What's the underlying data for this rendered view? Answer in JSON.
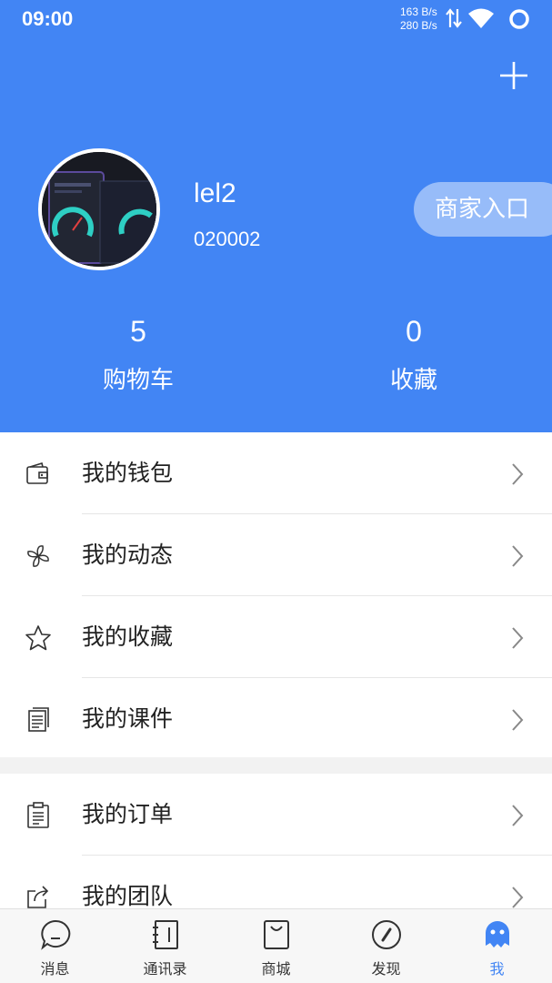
{
  "status_bar": {
    "time": "09:00",
    "upload_speed": "163 B/s",
    "download_speed": "280 B/s"
  },
  "profile": {
    "username": "lel2",
    "user_id": "020002",
    "merchant_entry": "商家入口"
  },
  "stats": [
    {
      "value": "5",
      "label": "购物车"
    },
    {
      "value": "0",
      "label": "收藏"
    }
  ],
  "menu_group_1": [
    {
      "label": "我的钱包",
      "icon": "wallet-icon"
    },
    {
      "label": "我的动态",
      "icon": "pinwheel-icon"
    },
    {
      "label": "我的收藏",
      "icon": "star-icon"
    },
    {
      "label": "我的课件",
      "icon": "document-icon"
    }
  ],
  "menu_group_2": [
    {
      "label": "我的订单",
      "icon": "clipboard-icon"
    },
    {
      "label": "我的团队",
      "icon": "share-icon"
    }
  ],
  "tabbar": {
    "active_color": "#4285f4",
    "tabs": [
      {
        "label": "消息",
        "icon": "chat-icon"
      },
      {
        "label": "通讯录",
        "icon": "contacts-icon"
      },
      {
        "label": "商城",
        "icon": "shopping-bag-icon"
      },
      {
        "label": "发现",
        "icon": "compass-icon"
      },
      {
        "label": "我",
        "icon": "me-icon"
      }
    ]
  },
  "colors": {
    "header_bg": "#4285f4",
    "page_bg": "#f2f2f2"
  }
}
